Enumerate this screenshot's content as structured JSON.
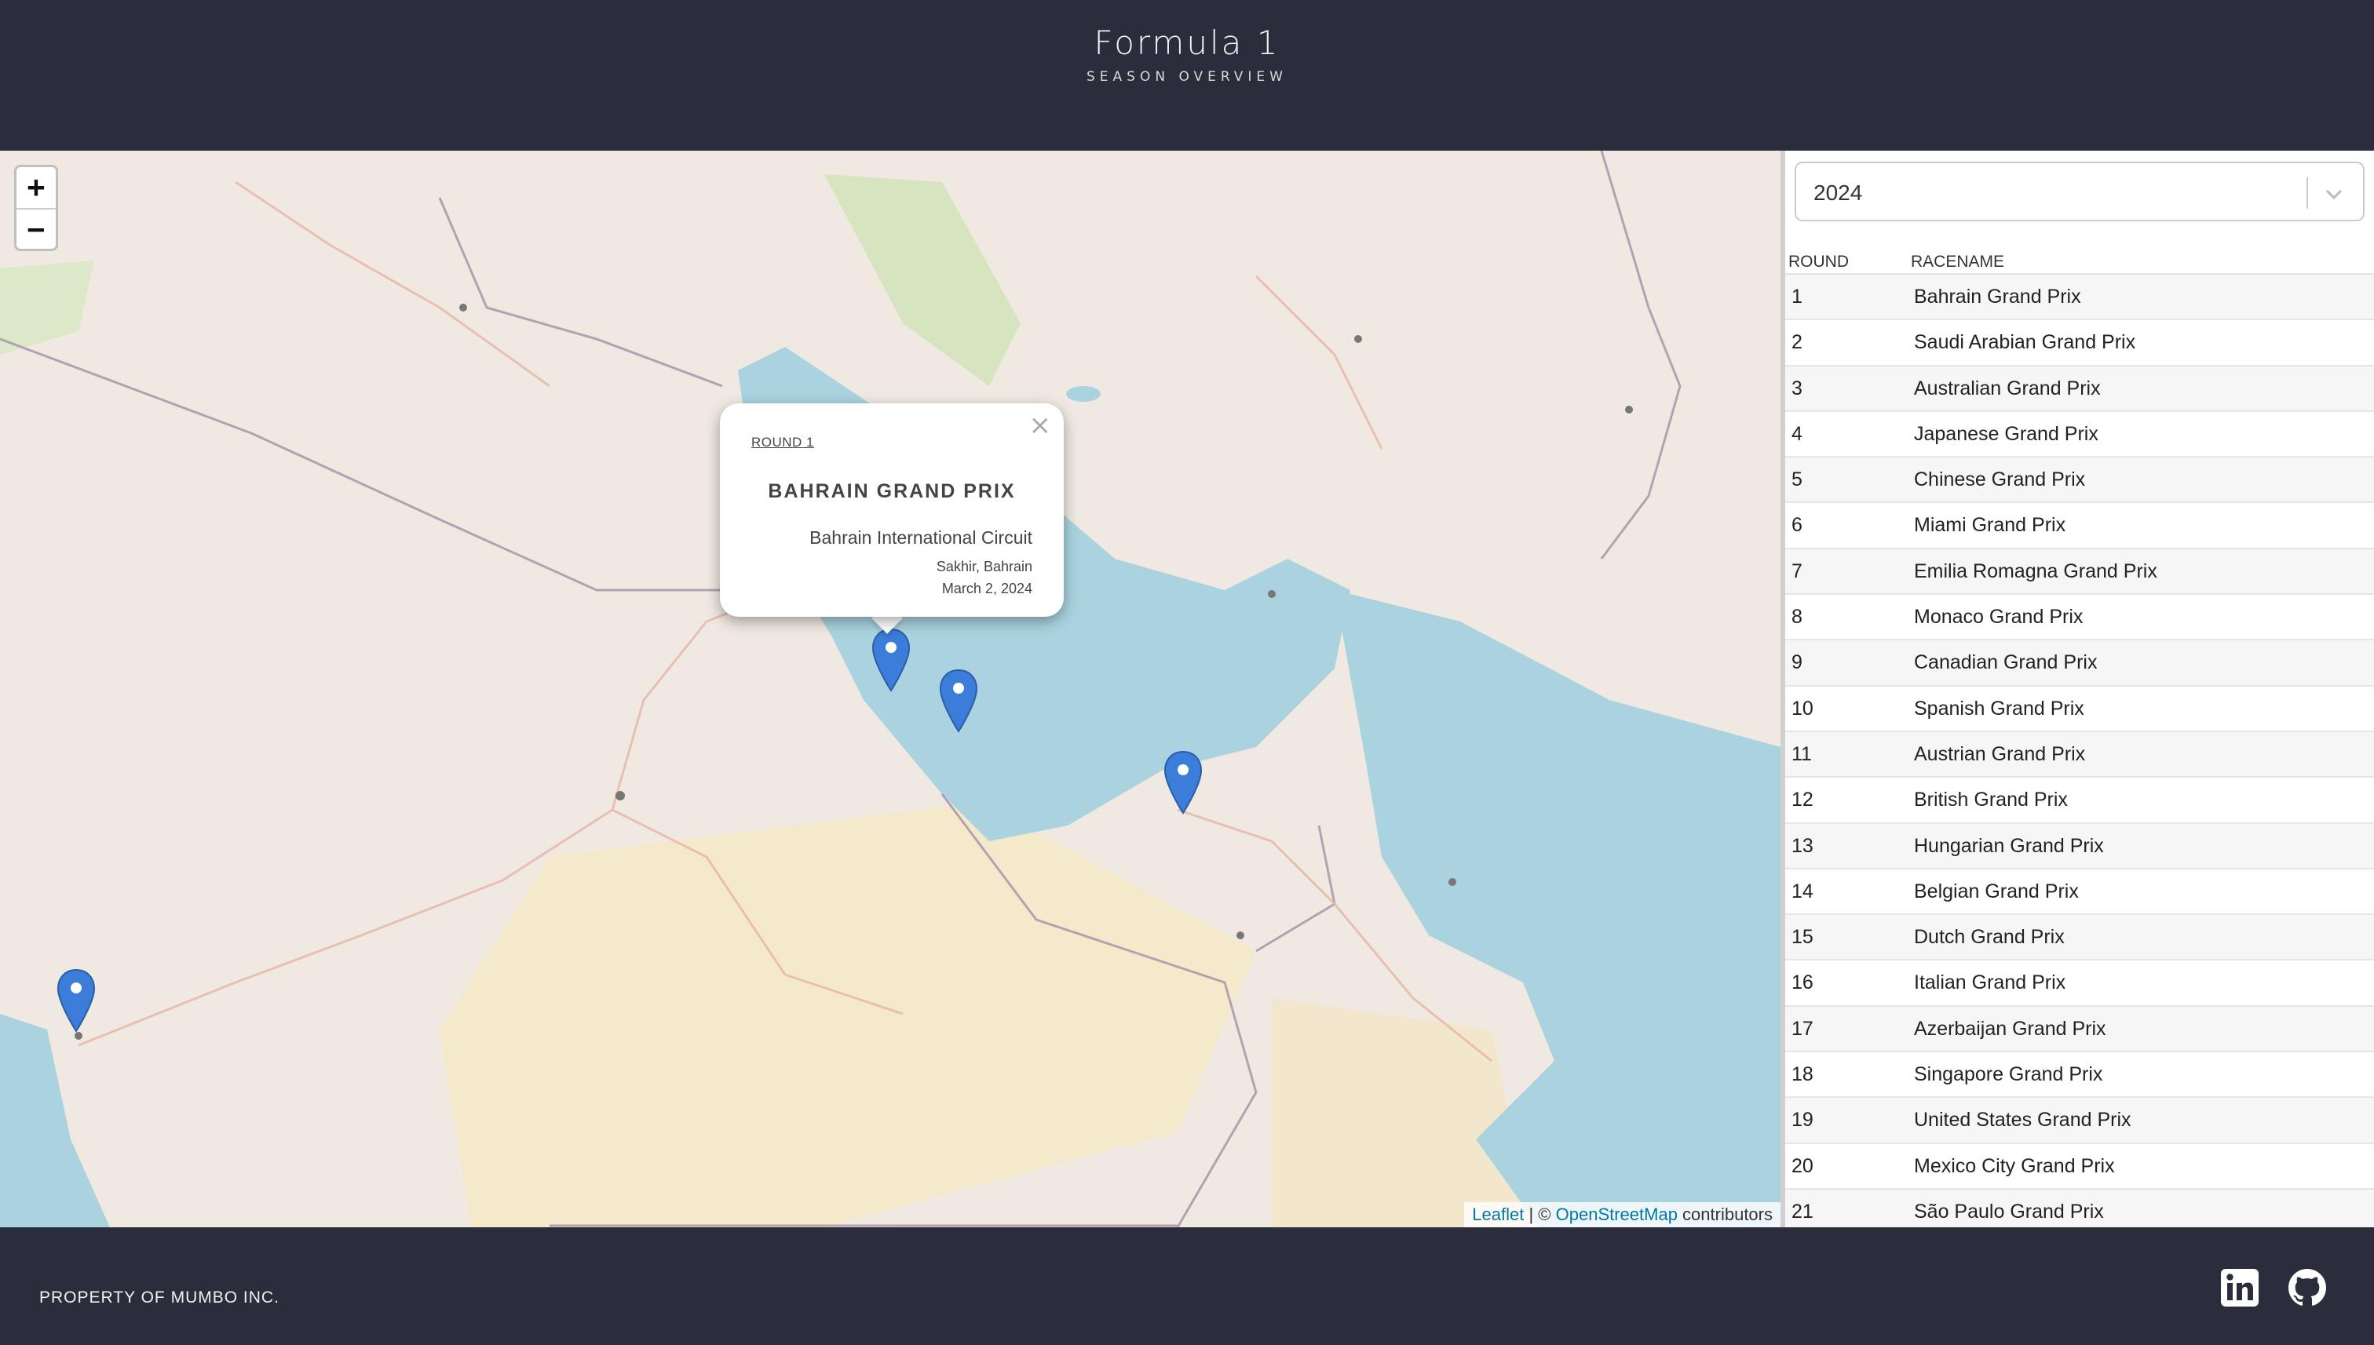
{
  "header": {
    "title": "Formula 1",
    "subtitle": "SEASON OVERVIEW"
  },
  "map": {
    "zoom_in": "+",
    "zoom_out": "−",
    "attribution": {
      "leaflet": "Leaflet",
      "separator": " | © ",
      "osm": "OpenStreetMap",
      "suffix": " contributors"
    },
    "popup": {
      "close": "×",
      "round": "ROUND 1",
      "race": "BAHRAIN GRAND PRIX",
      "circuit": "Bahrain International Circuit",
      "location": "Sakhir, Bahrain",
      "date": "March 2, 2024"
    },
    "markers": [
      "marker-bahrain",
      "marker-qatar",
      "marker-abu-dhabi",
      "marker-jeddah"
    ]
  },
  "panel": {
    "season": "2024",
    "columns": {
      "round": "ROUND",
      "racename": "RACENAME"
    },
    "races": [
      {
        "round": "1",
        "name": "Bahrain Grand Prix"
      },
      {
        "round": "2",
        "name": "Saudi Arabian Grand Prix"
      },
      {
        "round": "3",
        "name": "Australian Grand Prix"
      },
      {
        "round": "4",
        "name": "Japanese Grand Prix"
      },
      {
        "round": "5",
        "name": "Chinese Grand Prix"
      },
      {
        "round": "6",
        "name": "Miami Grand Prix"
      },
      {
        "round": "7",
        "name": "Emilia Romagna Grand Prix"
      },
      {
        "round": "8",
        "name": "Monaco Grand Prix"
      },
      {
        "round": "9",
        "name": "Canadian Grand Prix"
      },
      {
        "round": "10",
        "name": "Spanish Grand Prix"
      },
      {
        "round": "11",
        "name": "Austrian Grand Prix"
      },
      {
        "round": "12",
        "name": "British Grand Prix"
      },
      {
        "round": "13",
        "name": "Hungarian Grand Prix"
      },
      {
        "round": "14",
        "name": "Belgian Grand Prix"
      },
      {
        "round": "15",
        "name": "Dutch Grand Prix"
      },
      {
        "round": "16",
        "name": "Italian Grand Prix"
      },
      {
        "round": "17",
        "name": "Azerbaijan Grand Prix"
      },
      {
        "round": "18",
        "name": "Singapore Grand Prix"
      },
      {
        "round": "19",
        "name": "United States Grand Prix"
      },
      {
        "round": "20",
        "name": "Mexico City Grand Prix"
      },
      {
        "round": "21",
        "name": "São Paulo Grand Prix"
      }
    ]
  },
  "footer": {
    "text": "PROPERTY OF MUMBO INC.",
    "linkedin": "linkedin-icon",
    "github": "github-icon"
  },
  "colors": {
    "background": "#2b2d3c",
    "marker": "#3b7dd8",
    "sea": "#aad3df",
    "land": "#efe9e1"
  }
}
